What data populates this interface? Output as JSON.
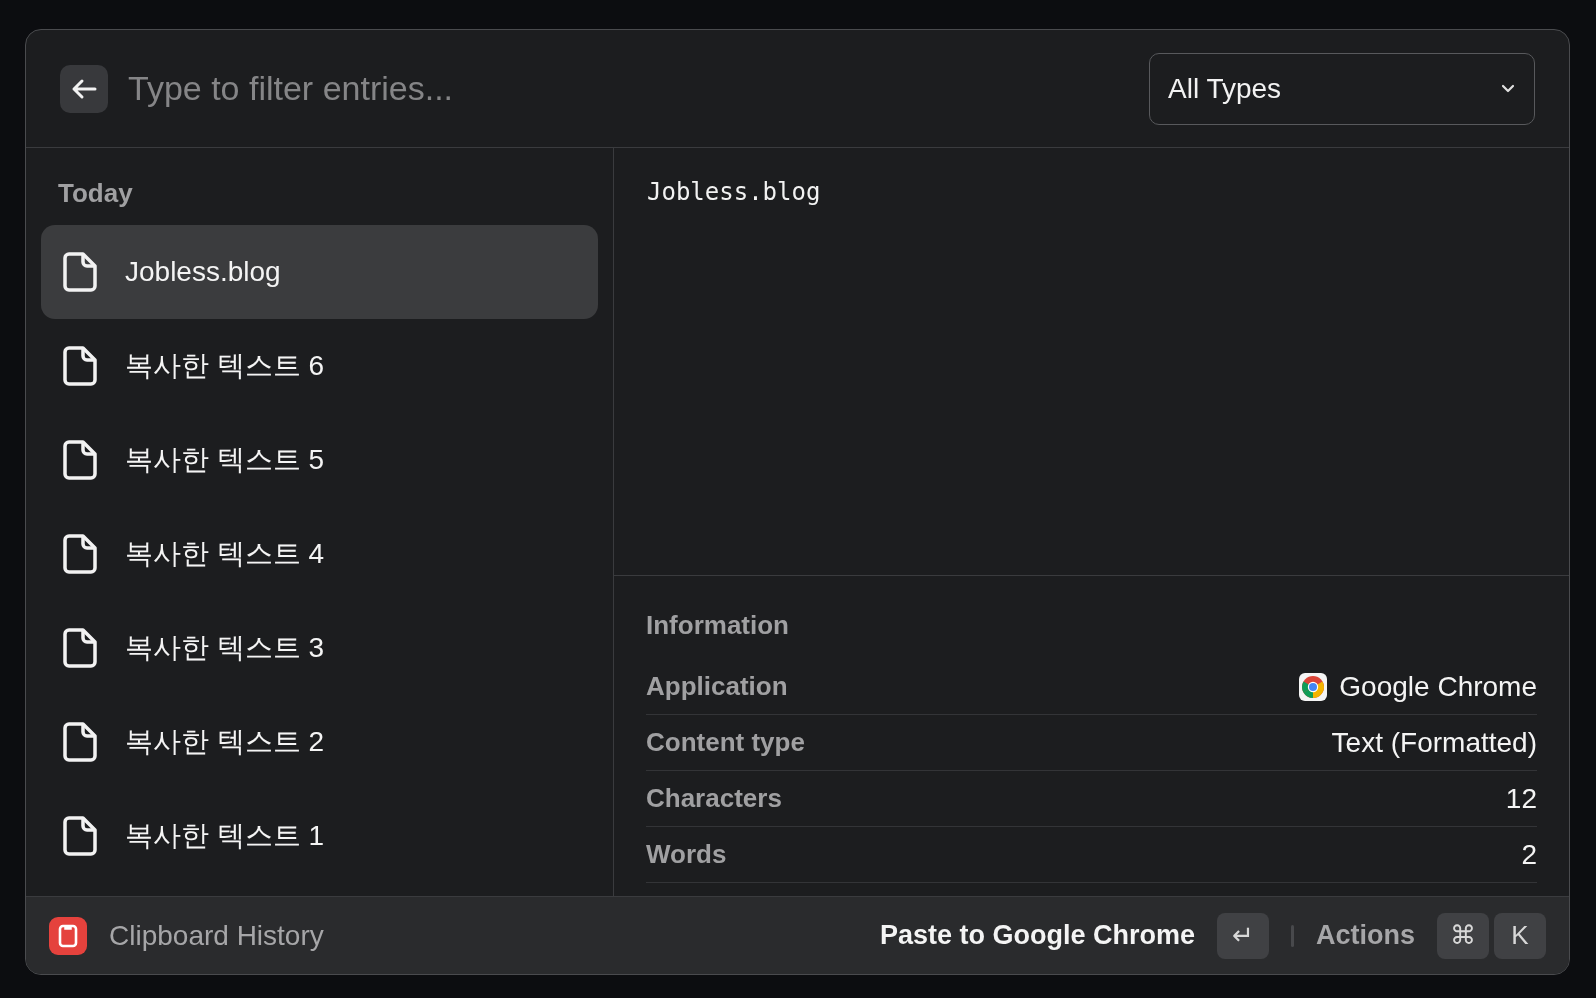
{
  "search": {
    "placeholder": "Type to filter entries..."
  },
  "type_filter": {
    "value": "All Types"
  },
  "list": {
    "section": "Today",
    "items": [
      {
        "label": "Jobless.blog",
        "selected": true
      },
      {
        "label": "복사한 텍스트 6",
        "selected": false
      },
      {
        "label": "복사한 텍스트 5",
        "selected": false
      },
      {
        "label": "복사한 텍스트 4",
        "selected": false
      },
      {
        "label": "복사한 텍스트 3",
        "selected": false
      },
      {
        "label": "복사한 텍스트 2",
        "selected": false
      },
      {
        "label": "복사한 텍스트 1",
        "selected": false
      }
    ]
  },
  "preview": {
    "text": "Jobless.blog"
  },
  "information": {
    "title": "Information",
    "rows": [
      {
        "label": "Application",
        "value": "Google Chrome",
        "kind": "app"
      },
      {
        "label": "Content type",
        "value": "Text (Formatted)",
        "kind": "text"
      },
      {
        "label": "Characters",
        "value": "12",
        "kind": "text"
      },
      {
        "label": "Words",
        "value": "2",
        "kind": "text"
      }
    ]
  },
  "footer": {
    "title": "Clipboard History",
    "primary_action": "Paste to Google Chrome",
    "primary_key": "↵",
    "actions_label": "Actions",
    "action_keys": [
      "⌘",
      "K"
    ]
  }
}
